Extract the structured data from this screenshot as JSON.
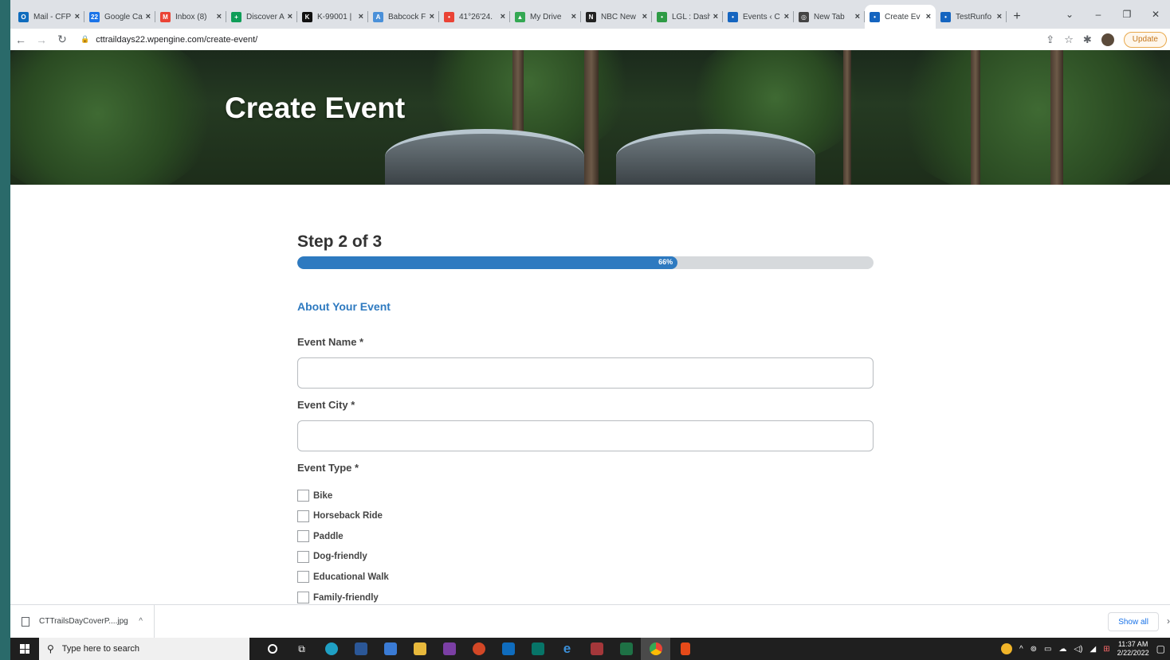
{
  "browser": {
    "tabs": [
      {
        "title": "Mail - CFP",
        "color": "#0f6cbd",
        "glyph": "O"
      },
      {
        "title": "Google Ca",
        "color": "#1a73e8",
        "glyph": "22"
      },
      {
        "title": "Inbox (8)",
        "color": "#ea4335",
        "glyph": "M"
      },
      {
        "title": "Discover A",
        "color": "#0f9d58",
        "glyph": "+"
      },
      {
        "title": "K-99001 |",
        "color": "#111111",
        "glyph": "K"
      },
      {
        "title": "Babcock F",
        "color": "#4a90d9",
        "glyph": "A"
      },
      {
        "title": "41°26'24.",
        "color": "#ea4335",
        "glyph": "•"
      },
      {
        "title": "My Drive",
        "color": "#34a853",
        "glyph": "▲"
      },
      {
        "title": "NBC New",
        "color": "#222222",
        "glyph": "N"
      },
      {
        "title": "LGL : Dash",
        "color": "#2e9b45",
        "glyph": "•"
      },
      {
        "title": "Events ‹ C",
        "color": "#1565c0",
        "glyph": "•"
      },
      {
        "title": "New Tab",
        "color": "#444444",
        "glyph": "◎"
      },
      {
        "title": "Create Ev",
        "color": "#1565c0",
        "glyph": "•",
        "active": true
      },
      {
        "title": "TestRunfo",
        "color": "#1565c0",
        "glyph": "•"
      }
    ],
    "new_tab_glyph": "+",
    "window_controls": [
      "⌄",
      "–",
      "❐",
      "✕"
    ],
    "url": "cttraildays22.wpengine.com/create-event/",
    "update_label": "Update"
  },
  "page": {
    "hero_title": "Create Event",
    "step_title": "Step 2 of 3",
    "progress": {
      "value": 66,
      "label": "66%"
    },
    "section_title": "About Your Event",
    "fields": {
      "event_name": {
        "label": "Event Name",
        "required_mark": "*",
        "value": ""
      },
      "event_city": {
        "label": "Event City",
        "required_mark": "*",
        "value": ""
      }
    },
    "event_type": {
      "label": "Event Type",
      "required_mark": "*",
      "options": [
        "Bike",
        "Horseback Ride",
        "Paddle",
        "Dog-friendly",
        "Educational Walk",
        "Family-friendly"
      ]
    }
  },
  "downloads": {
    "file_name": "CTTrailsDayCoverP....jpg",
    "show_all_label": "Show all"
  },
  "taskbar": {
    "search_placeholder": "Type here to search",
    "time": "11:37 AM",
    "date": "2/22/2022"
  }
}
